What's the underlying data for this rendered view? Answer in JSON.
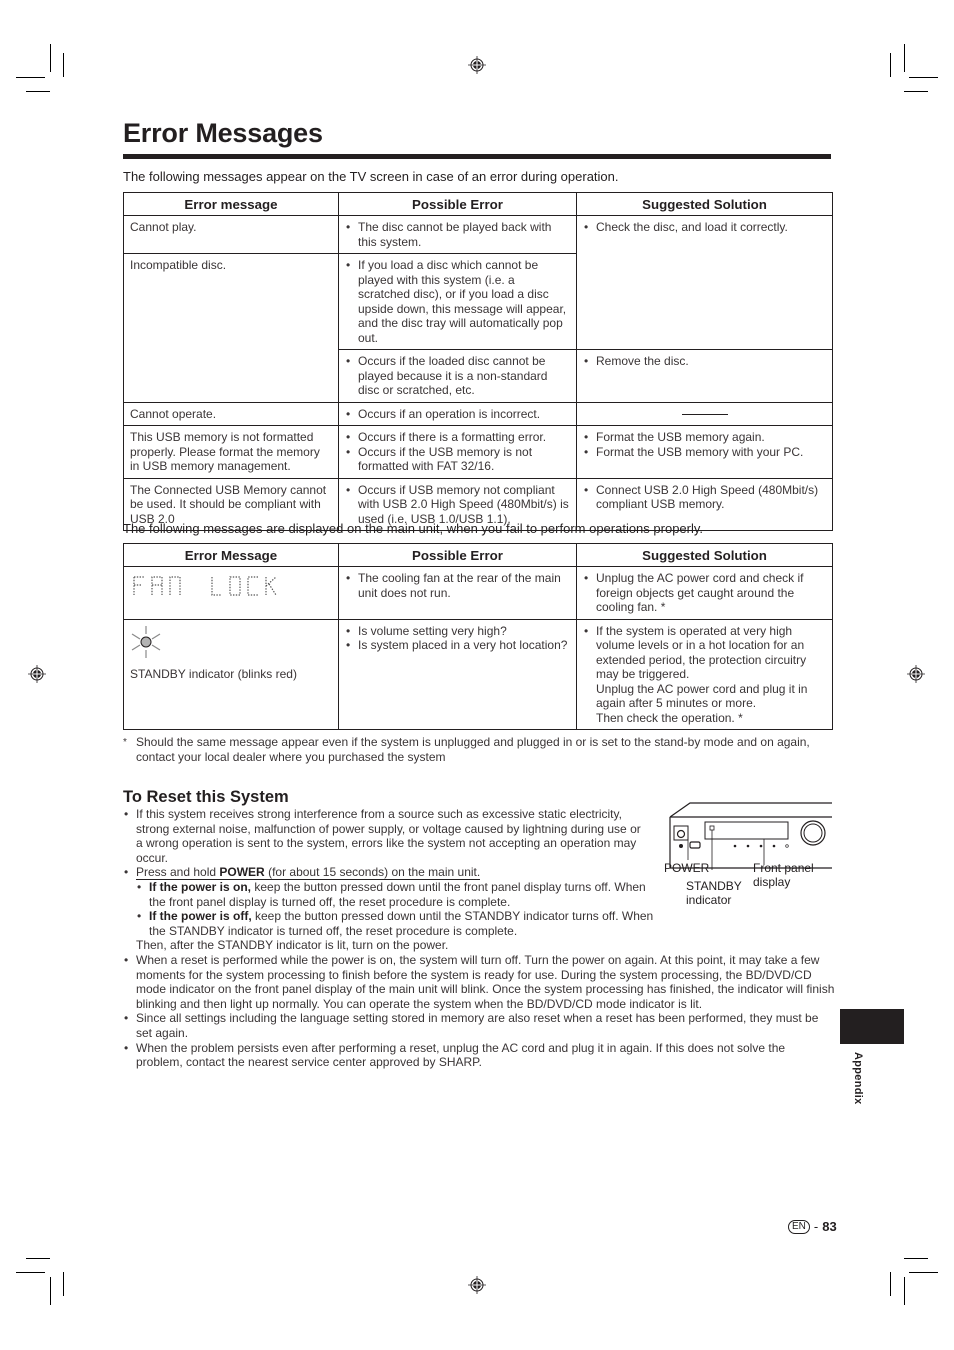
{
  "page": {
    "title": "Error Messages",
    "intro_tv": "The following messages appear on the TV screen in case of an error during operation.",
    "intro_unit": "The following messages are displayed on the main unit, when you fail to perform operations properly."
  },
  "table_tv": {
    "headers": [
      "Error message",
      "Possible Error",
      "Suggested Solution"
    ],
    "rows": [
      {
        "message": "Cannot play.",
        "errors": [
          "The disc cannot be played back with this system."
        ],
        "solutions": [
          "Check the disc, and load it correctly."
        ]
      },
      {
        "message": "Incompatible disc.",
        "errors": [
          "If you load a disc which cannot be played with this system (i.e. a scratched disc), or if you load a disc upside down, this message will appear, and the disc tray will automatically pop out."
        ],
        "solutions": []
      },
      {
        "message": "",
        "errors": [
          "Occurs if the loaded disc cannot be played because it is a non-standard disc or scratched, etc."
        ],
        "solutions": [
          "Remove the disc."
        ]
      },
      {
        "message": "Cannot operate.",
        "errors": [
          "Occurs if an operation is incorrect."
        ],
        "solutions": [
          "———"
        ]
      },
      {
        "message": "This USB memory is not formatted properly. Please format the memory in USB memory management.",
        "errors": [
          "Occurs if there is a formatting error.",
          "Occurs if the USB memory is not formatted with FAT 32/16."
        ],
        "solutions": [
          "Format the USB memory again.",
          "Format the USB memory with your PC."
        ]
      },
      {
        "message": "The Connected USB Memory cannot be used. It should be compliant with USB 2.0",
        "errors": [
          "Occurs if USB memory not compliant with USB 2.0 High Speed (480Mbit/s) is used (i.e. USB 1.0/USB 1.1)."
        ],
        "solutions": [
          "Connect USB 2.0 High Speed (480Mbit/s) compliant USB memory."
        ]
      }
    ]
  },
  "table_unit": {
    "headers": [
      "Error Message",
      "Possible Error",
      "Suggested Solution"
    ],
    "rows": [
      {
        "message": "FAN LOCK",
        "message_icon": "lcd-segment-display",
        "errors": [
          "The cooling fan at the rear of the main unit does not run."
        ],
        "solutions": [
          "Unplug the AC power cord and check if foreign objects get caught around the cooling fan. *"
        ]
      },
      {
        "message": "STANDBY indicator (blinks red)",
        "message_icon": "blinking-indicator-icon",
        "errors": [
          "Is volume setting very high?",
          "Is system placed in a very hot location?"
        ],
        "solutions": [
          "If the system is operated at very high volume levels or in a hot location for an extended period, the protection circuitry may be triggered.",
          "Unplug the AC power cord and plug it in again after 5 minutes or more.",
          "Then check the operation. *"
        ]
      }
    ]
  },
  "footnote": {
    "mark": "*",
    "text": "Should the same message appear even if the system is unplugged and plugged in or is set to the stand-by mode and on again, contact your local dealer where you purchased the system"
  },
  "reset": {
    "title": "To Reset this System",
    "b1": "If this system receives strong interference from a source such as excessive static electricity, strong external noise, malfunction of power supply, or voltage caused by lightning during use or a wrong operation is sent to the system, errors like the system not accepting an operation may occur.",
    "b2_pre": "Press and hold ",
    "b2_bold": "POWER",
    "b2_post": " (for about 15 seconds) on the main unit.",
    "sub1_bold": "If the power is on,",
    "sub1_text": " keep the button pressed down until the front panel display turns off. When the front panel display is turned off, the reset procedure is complete.",
    "sub2_bold": "If the power is off,",
    "sub2_text": " keep the button pressed down until the STANDBY indicator turns off. When the STANDBY indicator is turned off, the reset procedure is complete.",
    "then": "Then, after the STANDBY indicator is lit, turn on the power.",
    "b3": "When a reset is performed while the power is on, the system will turn off. Turn the power on again. At this point, it may take a few moments for the system processing to finish before the system is ready for use. During the system processing, the BD/DVD/CD mode indicator on the front panel display of the main unit will blink. Once the system processing has finished, the indicator will finish blinking and then light up normally. You can operate the system when the BD/DVD/CD mode indicator is lit.",
    "b4": "Since all settings including the language setting stored in memory are also reset when a reset has been performed, they must be set again.",
    "b5": "When the problem persists even after performing a reset, unplug the AC cord and plug it in again. If this does not solve the problem, contact the nearest service center approved by SHARP."
  },
  "diagram": {
    "label_power": "POWER",
    "label_standby_1": "STANDBY",
    "label_standby_2": "indicator",
    "label_display_1": "Front panel",
    "label_display_2": "display"
  },
  "side": {
    "section": "Appendix"
  },
  "footer": {
    "lang": "EN",
    "sep": "-",
    "page_number": "83"
  }
}
